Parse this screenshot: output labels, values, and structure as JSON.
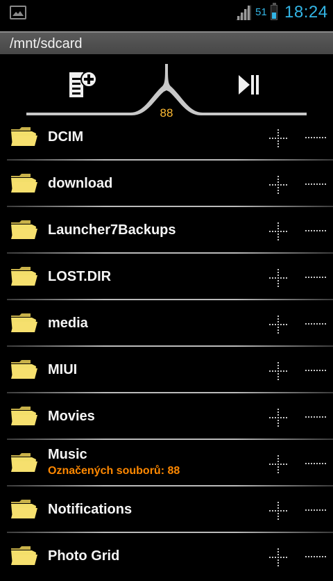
{
  "status": {
    "battery": "51",
    "time": "18:24"
  },
  "path": "/mnt/sdcard",
  "toolbar": {
    "selected_count": "88"
  },
  "items": [
    {
      "name": "DCIM",
      "subtitle": ""
    },
    {
      "name": "download",
      "subtitle": ""
    },
    {
      "name": "Launcher7Backups",
      "subtitle": ""
    },
    {
      "name": "LOST.DIR",
      "subtitle": ""
    },
    {
      "name": "media",
      "subtitle": ""
    },
    {
      "name": "MIUI",
      "subtitle": ""
    },
    {
      "name": "Movies",
      "subtitle": ""
    },
    {
      "name": "Music",
      "subtitle": "Označených souborů: 88"
    },
    {
      "name": "Notifications",
      "subtitle": ""
    },
    {
      "name": "Photo Grid",
      "subtitle": ""
    }
  ],
  "colors": {
    "accent_blue": "#33b5e5",
    "accent_orange": "#ff8800",
    "count_yellow": "#ffbb33",
    "folder_yellow": "#f3df6b"
  }
}
